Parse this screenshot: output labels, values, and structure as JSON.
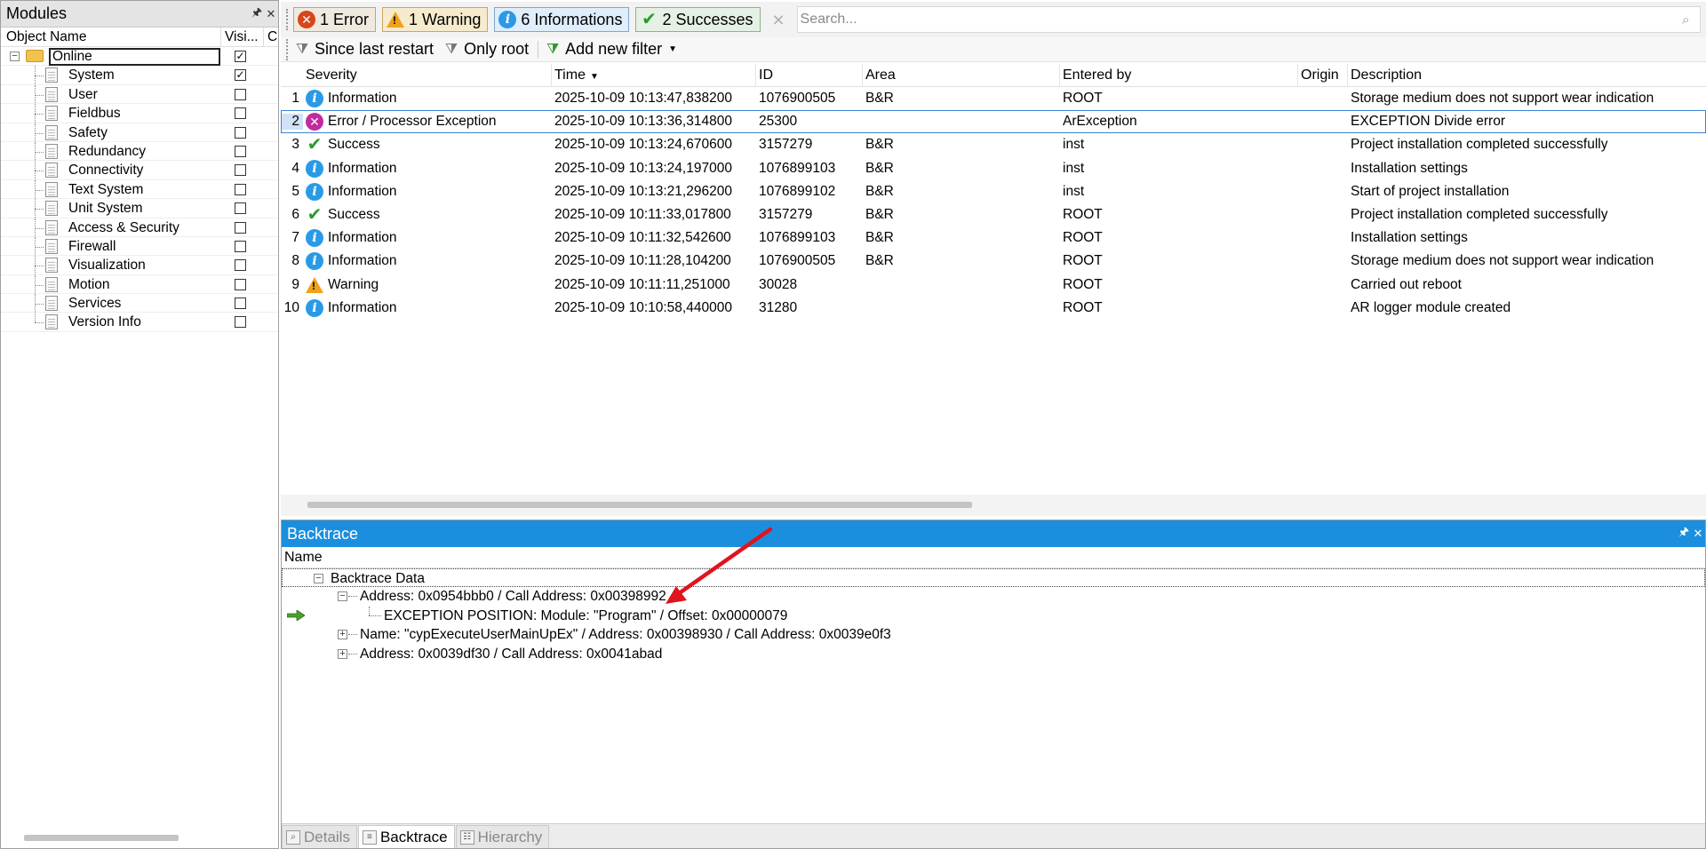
{
  "modules": {
    "title": "Modules",
    "pin_icon": "pin-icon",
    "close_icon": "close-icon",
    "columns": {
      "object_name": "Object Name",
      "visible": "Visi...",
      "c": "C"
    },
    "root": {
      "label": "Online",
      "checked": true
    },
    "items": [
      {
        "label": "System",
        "checked": true
      },
      {
        "label": "User",
        "checked": false
      },
      {
        "label": "Fieldbus",
        "checked": false
      },
      {
        "label": "Safety",
        "checked": false
      },
      {
        "label": "Redundancy",
        "checked": false
      },
      {
        "label": "Connectivity",
        "checked": false
      },
      {
        "label": "Text System",
        "checked": false
      },
      {
        "label": "Unit System",
        "checked": false
      },
      {
        "label": "Access & Security",
        "checked": false
      },
      {
        "label": "Firewall",
        "checked": false
      },
      {
        "label": "Visualization",
        "checked": false
      },
      {
        "label": "Motion",
        "checked": false
      },
      {
        "label": "Services",
        "checked": false
      },
      {
        "label": "Version Info",
        "checked": false
      }
    ]
  },
  "toolbar": {
    "error_label": "1 Error",
    "warning_label": "1 Warning",
    "info_label": "6 Informations",
    "success_label": "2 Successes",
    "search_placeholder": "Search...",
    "since_restart_label": "Since last restart",
    "only_root_label": "Only root",
    "add_filter_label": "Add new filter"
  },
  "log": {
    "columns": {
      "severity": "Severity",
      "time": "Time",
      "id": "ID",
      "area": "Area",
      "entered_by": "Entered by",
      "origin": "Origin",
      "description": "Description"
    },
    "rows": [
      {
        "num": "1",
        "severity": "Information",
        "icon": "info",
        "time": "2025-10-09 10:13:47,838200",
        "id": "1076900505",
        "area": "B&R",
        "entered_by": "ROOT",
        "origin": "",
        "description": "Storage medium does not support wear indication"
      },
      {
        "num": "2",
        "severity": "Error / Processor Exception",
        "icon": "exception",
        "time": "2025-10-09 10:13:36,314800",
        "id": "25300",
        "area": "",
        "entered_by": "ArException",
        "origin": "",
        "description": "EXCEPTION Divide error"
      },
      {
        "num": "3",
        "severity": "Success",
        "icon": "success",
        "time": "2025-10-09 10:13:24,670600",
        "id": "3157279",
        "area": "B&R",
        "entered_by": "inst",
        "origin": "",
        "description": "Project installation completed successfully"
      },
      {
        "num": "4",
        "severity": "Information",
        "icon": "info",
        "time": "2025-10-09 10:13:24,197000",
        "id": "1076899103",
        "area": "B&R",
        "entered_by": "inst",
        "origin": "",
        "description": "Installation settings"
      },
      {
        "num": "5",
        "severity": "Information",
        "icon": "info",
        "time": "2025-10-09 10:13:21,296200",
        "id": "1076899102",
        "area": "B&R",
        "entered_by": "inst",
        "origin": "",
        "description": "Start of project installation"
      },
      {
        "num": "6",
        "severity": "Success",
        "icon": "success",
        "time": "2025-10-09 10:11:33,017800",
        "id": "3157279",
        "area": "B&R",
        "entered_by": "ROOT",
        "origin": "",
        "description": "Project installation completed successfully"
      },
      {
        "num": "7",
        "severity": "Information",
        "icon": "info",
        "time": "2025-10-09 10:11:32,542600",
        "id": "1076899103",
        "area": "B&R",
        "entered_by": "ROOT",
        "origin": "",
        "description": "Installation settings"
      },
      {
        "num": "8",
        "severity": "Information",
        "icon": "info",
        "time": "2025-10-09 10:11:28,104200",
        "id": "1076900505",
        "area": "B&R",
        "entered_by": "ROOT",
        "origin": "",
        "description": "Storage medium does not support wear indication"
      },
      {
        "num": "9",
        "severity": "Warning",
        "icon": "warning",
        "time": "2025-10-09 10:11:11,251000",
        "id": "30028",
        "area": "",
        "entered_by": "ROOT",
        "origin": "",
        "description": "Carried out reboot"
      },
      {
        "num": "10",
        "severity": "Information",
        "icon": "info",
        "time": "2025-10-09 10:10:58,440000",
        "id": "31280",
        "area": "",
        "entered_by": "ROOT",
        "origin": "",
        "description": "AR logger module created"
      }
    ]
  },
  "backtrace": {
    "title": "Backtrace",
    "column": "Name",
    "root_label": "Backtrace Data",
    "nodes": [
      {
        "text": "Address: 0x0954bbb0 / Call Address: 0x00398992"
      },
      {
        "text": "EXCEPTION POSITION: Module: \"Program\" / Offset: 0x00000079"
      },
      {
        "text": "Name: \"cypExecuteUserMainUpEx\" / Address: 0x00398930 / Call Address: 0x0039e0f3"
      },
      {
        "text": "Address: 0x0039df30 / Call Address: 0x0041abad"
      }
    ],
    "tabs": [
      "Details",
      "Backtrace",
      "Hierarchy"
    ],
    "active_tab": "Backtrace"
  },
  "colors": {
    "accent": "#1b8fde",
    "annotation": "#e0141e",
    "error": "#d7471b",
    "info": "#2b9ae6",
    "success": "#2a9a2a",
    "warning": "#f0a21a",
    "exception": "#c02ba0"
  }
}
